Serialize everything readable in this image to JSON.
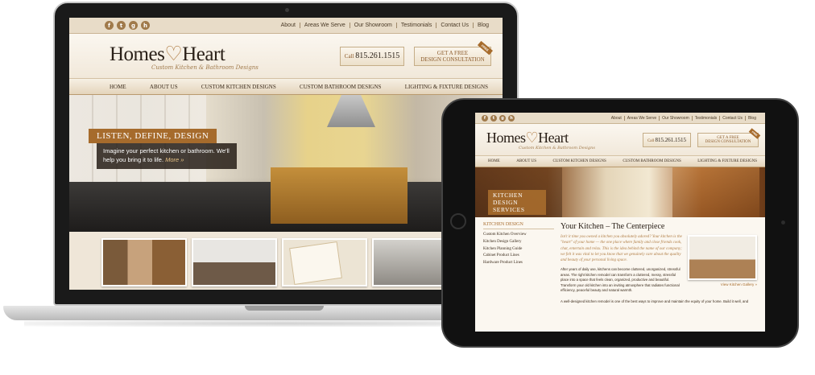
{
  "site": {
    "logo": {
      "word1": "Homes",
      "heart": "♡",
      "word2": "Heart",
      "tagline": "Custom Kitchen & Bathroom Designs"
    },
    "social_icons": [
      {
        "name": "facebook-icon",
        "glyph": "f"
      },
      {
        "name": "twitter-icon",
        "glyph": "t"
      },
      {
        "name": "googleplus-icon",
        "glyph": "g"
      },
      {
        "name": "houzz-icon",
        "glyph": "h"
      }
    ],
    "top_links": [
      "About",
      "Areas We Serve",
      "Our Showroom",
      "Testimonials",
      "Contact Us",
      "Blog"
    ],
    "call": {
      "label": "Call",
      "phone": "815.261.1515"
    },
    "consult": {
      "line1": "GET A FREE",
      "line2": "DESIGN CONSULTATION",
      "ribbon": "FREE"
    },
    "nav": [
      "Home",
      "About Us",
      "Custom Kitchen Designs",
      "Custom Bathroom Designs",
      "Lighting & Fixture Designs"
    ],
    "colors": {
      "accent": "#a66b2c",
      "cream": "#efe6d8",
      "dark": "#2a2018"
    }
  },
  "laptop": {
    "hero_title": "LISTEN, DEFINE, DESIGN",
    "hero_text": "Imagine your perfect kitchen or bathroom. We'll help you bring it to life.",
    "hero_more": "More »"
  },
  "tablet": {
    "banner_title": "Kitchen Design Services",
    "sidebar": {
      "heading": "Kitchen Design",
      "items": [
        "Custom Kitchen Overview",
        "Kitchen Design Gallery",
        "Kitchen Planning Guide",
        "Cabinet Product Lines",
        "Hardware Product Lines"
      ]
    },
    "content": {
      "title": "Your Kitchen – The Centerpiece",
      "lead": "Isn't it time you owned a kitchen you absolutely adored? Your kitchen is the \"heart\" of your home — the one place where family and close friends cook, chat, entertain and relax. This is the idea behind the name of our company; we felt it was vital to let you know that we genuinely care about the quality and beauty of your personal living space.",
      "body": "After years of daily use, kitchens can become cluttered, unorganized, stressful areas. The right kitchen remodel can transform a cluttered, messy, stressful place into a space that feels clean, organized, productive and beautiful. Transform your old kitchen into an inviting atmosphere that radiates functional efficiency, peaceful beauty and natural warmth.",
      "foot": "A well-designed kitchen remodel is one of the best ways to improve and maintain the equity of your home. Build it well, and",
      "gallery_link": "View Kitchen Gallery »"
    }
  }
}
